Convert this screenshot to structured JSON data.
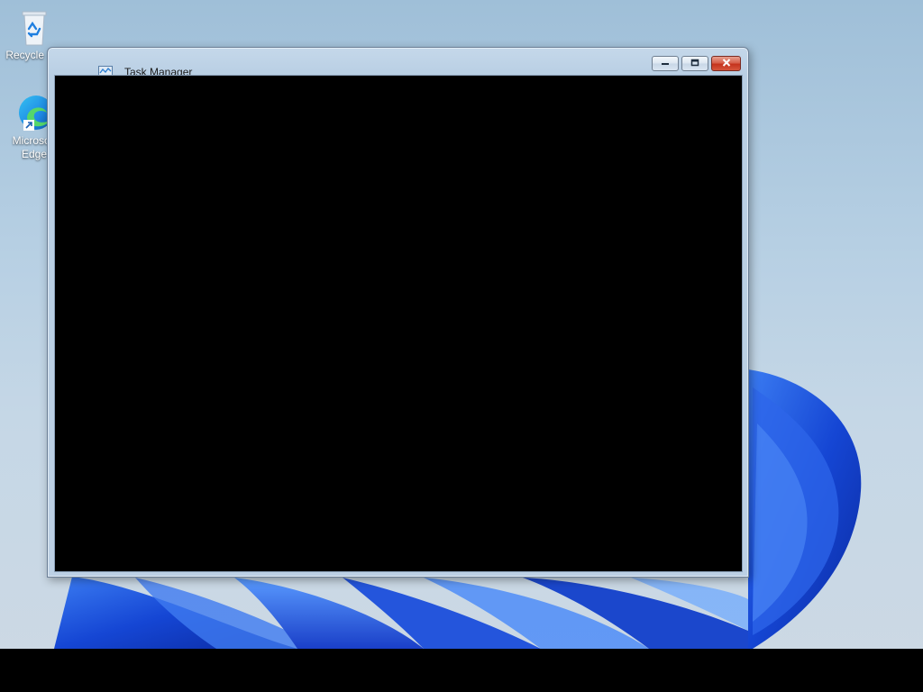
{
  "desktop": {
    "icons": [
      {
        "label": "Recycle Bin",
        "icon": "recycle-bin-icon"
      },
      {
        "label": "Microsoft Edge",
        "icon": "edge-icon"
      }
    ]
  },
  "window": {
    "title": "Task Manager",
    "app_icon": "task-manager-icon",
    "buttons": {
      "minimize": "minimize-icon",
      "maximize": "maximize-icon",
      "close": "close-icon"
    }
  },
  "colors": {
    "wallpaper_bloom": "#1a4fd6",
    "client_area": "#000000",
    "taskbar": "#000000",
    "close_button": "#c9442c"
  }
}
